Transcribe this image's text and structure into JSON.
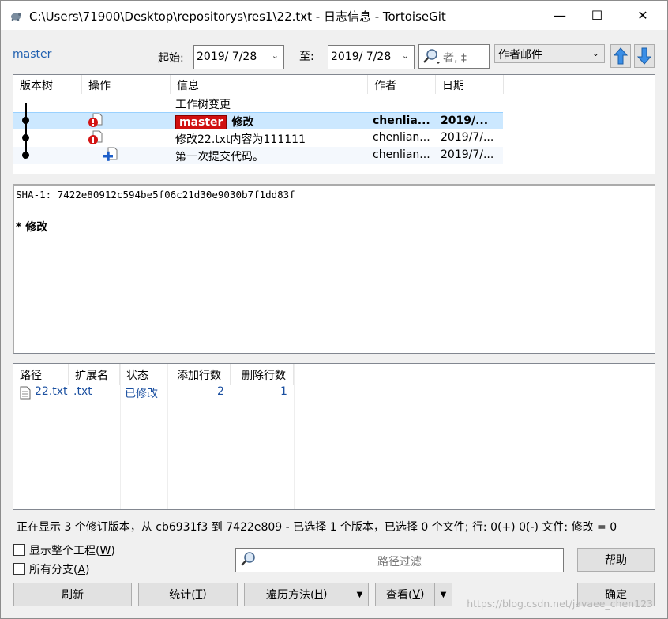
{
  "window": {
    "title": "C:\\Users\\71900\\Desktop\\repositorys\\res1\\22.txt - 日志信息 - TortoiseGit",
    "controls": {
      "minimize": "—",
      "maximize": "☐",
      "close": "✕"
    }
  },
  "toolbar": {
    "branch": "master",
    "from_label": "起始:",
    "from_date": "2019/  7/28",
    "to_label": "至:",
    "to_date": "2019/  7/28",
    "search_placeholder": "者, ‡",
    "filter_field": "作者邮件",
    "up_icon": "up-arrow-icon",
    "down_icon": "down-arrow-icon"
  },
  "log": {
    "headers": [
      "版本树",
      "操作",
      "信息",
      "作者",
      "日期"
    ],
    "rows": [
      {
        "message": "工作树变更",
        "author": "",
        "date": "",
        "tag": "",
        "bold": false
      },
      {
        "message": "修改",
        "author": "chenlia...",
        "date": "2019/...",
        "tag": "master",
        "bold": true
      },
      {
        "message": "修改22.txt内容为111111",
        "author": "chenlian...",
        "date": "2019/7/...",
        "tag": "",
        "bold": false
      },
      {
        "message": "第一次提交代码。",
        "author": "chenlian...",
        "date": "2019/7/...",
        "tag": "",
        "bold": false
      }
    ]
  },
  "commit": {
    "sha_line": "SHA-1: 7422e80912c594be5f06c21d30e9030b7f1dd83f",
    "message_line": "* 修改"
  },
  "files": {
    "headers": [
      "路径",
      "扩展名",
      "状态",
      "添加行数",
      "删除行数"
    ],
    "rows": [
      {
        "path": "22.txt",
        "ext": ".txt",
        "status": "已修改",
        "added": "2",
        "deleted": "1"
      }
    ]
  },
  "status_text": "正在显示 3 个修订版本，从 cb6931f3 到 7422e809 - 已选择 1 个版本，已选择 0 个文件; 行: 0(+) 0(-) 文件: 修改 = 0",
  "options": {
    "show_whole_project": {
      "label": "显示整个工程(",
      "key": "W",
      "tail": ")"
    },
    "all_branches": {
      "label": "所有分支(",
      "key": "A",
      "tail": ")"
    }
  },
  "path_filter_placeholder": "路径过滤",
  "buttons": {
    "help": "帮助",
    "refresh": "刷新",
    "stats": {
      "label": "统计(",
      "key": "T",
      "tail": ")"
    },
    "walk": {
      "label": "遍历方法(",
      "key": "H",
      "tail": ")"
    },
    "view": {
      "label": "查看(",
      "key": "V",
      "tail": ")"
    },
    "ok": "确定"
  },
  "watermark": "https://blog.csdn.net/javaee_chen123"
}
